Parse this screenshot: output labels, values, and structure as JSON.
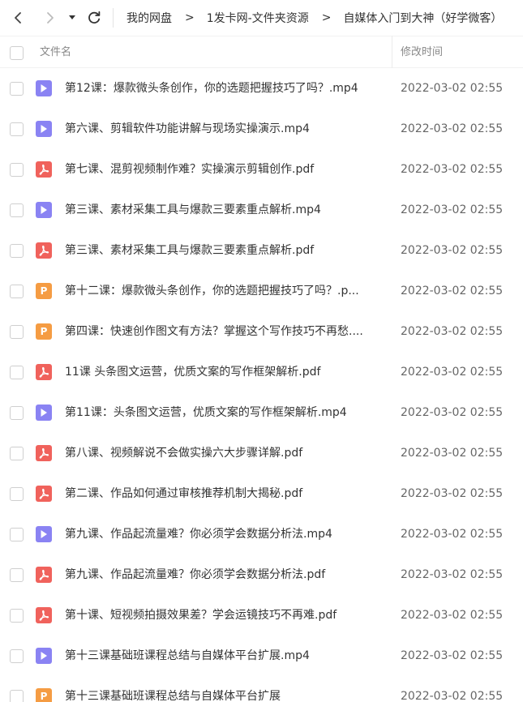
{
  "breadcrumb": [
    {
      "label": "我的网盘"
    },
    {
      "label": "1发卡网-文件夹资源"
    },
    {
      "label": "自媒体入门到大神（好学微客）"
    }
  ],
  "separator": ">",
  "table": {
    "col_name": "文件名",
    "col_time": "修改时间"
  },
  "files": [
    {
      "name": "第12课：爆款微头条创作，你的选题把握技巧了吗？.mp4",
      "type": "mp4",
      "icon": "video-file-icon",
      "modified": "2022-03-02 02:55"
    },
    {
      "name": "第六课、剪辑软件功能讲解与现场实操演示.mp4",
      "type": "mp4",
      "icon": "video-file-icon",
      "modified": "2022-03-02 02:55"
    },
    {
      "name": "第七课、混剪视频制作难？实操演示剪辑创作.pdf",
      "type": "pdf",
      "icon": "pdf-file-icon",
      "modified": "2022-03-02 02:55"
    },
    {
      "name": "第三课、素材采集工具与爆款三要素重点解析.mp4",
      "type": "mp4",
      "icon": "video-file-icon",
      "modified": "2022-03-02 02:55"
    },
    {
      "name": "第三课、素材采集工具与爆款三要素重点解析.pdf",
      "type": "pdf",
      "icon": "pdf-file-icon",
      "modified": "2022-03-02 02:55"
    },
    {
      "name": "第十二课：爆款微头条创作，你的选题把握技巧了吗？.p...",
      "type": "ppt",
      "icon": "ppt-file-icon",
      "modified": "2022-03-02 02:55"
    },
    {
      "name": "第四课：快速创作图文有方法？掌握这个写作技巧不再愁....",
      "type": "ppt",
      "icon": "ppt-file-icon",
      "modified": "2022-03-02 02:55"
    },
    {
      "name": "11课 头条图文运营，优质文案的写作框架解析.pdf",
      "type": "pdf",
      "icon": "pdf-file-icon",
      "modified": "2022-03-02 02:55"
    },
    {
      "name": "第11课：头条图文运营，优质文案的写作框架解析.mp4",
      "type": "mp4",
      "icon": "video-file-icon",
      "modified": "2022-03-02 02:55"
    },
    {
      "name": "第八课、视频解说不会做实操六大步骤详解.pdf",
      "type": "pdf",
      "icon": "pdf-file-icon",
      "modified": "2022-03-02 02:55"
    },
    {
      "name": "第二课、作品如何通过审核推荐机制大揭秘.pdf",
      "type": "pdf",
      "icon": "pdf-file-icon",
      "modified": "2022-03-02 02:55"
    },
    {
      "name": "第九课、作品起流量难？你必须学会数据分析法.mp4",
      "type": "mp4",
      "icon": "video-file-icon",
      "modified": "2022-03-02 02:55"
    },
    {
      "name": "第九课、作品起流量难？你必须学会数据分析法.pdf",
      "type": "pdf",
      "icon": "pdf-file-icon",
      "modified": "2022-03-02 02:55"
    },
    {
      "name": "第十课、短视频拍摄效果差？学会运镜技巧不再难.pdf",
      "type": "pdf",
      "icon": "pdf-file-icon",
      "modified": "2022-03-02 02:55"
    },
    {
      "name": "第十三课基础班课程总结与自媒体平台扩展.mp4",
      "type": "mp4",
      "icon": "video-file-icon",
      "modified": "2022-03-02 02:55"
    },
    {
      "name": "第十三课基础班课程总结与自媒体平台扩展",
      "type": "ppt",
      "icon": "ppt-file-icon",
      "modified": "2022-03-02 02:55"
    }
  ],
  "colors": {
    "mp4": "#8a83f3",
    "pdf": "#f0625c",
    "ppt": "#f59c43"
  }
}
